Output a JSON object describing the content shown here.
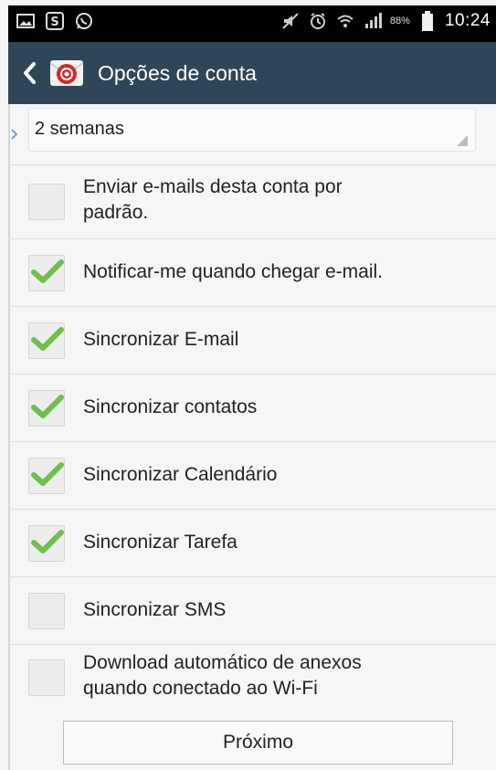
{
  "status_bar": {
    "left_icons": [
      "image-icon",
      "skype-icon",
      "whatsapp-icon"
    ],
    "right_icons": [
      "mute-icon",
      "alarm-icon",
      "wifi-icon",
      "signal-icon",
      "battery-icon"
    ],
    "battery_percent": "88%",
    "time": "10:24"
  },
  "action_bar": {
    "title": "Opções de conta",
    "background": "#2f4658"
  },
  "sync_period": {
    "selected": "2 semanas"
  },
  "options": [
    {
      "label_line1": "Enviar e-mails desta conta por",
      "label_line2": "padrão.",
      "checked": false
    },
    {
      "label_line1": "Notificar-me quando chegar e-mail.",
      "label_line2": "",
      "checked": true
    },
    {
      "label_line1": "Sincronizar E-mail",
      "label_line2": "",
      "checked": true
    },
    {
      "label_line1": "Sincronizar contatos",
      "label_line2": "",
      "checked": true
    },
    {
      "label_line1": "Sincronizar Calendário",
      "label_line2": "",
      "checked": true
    },
    {
      "label_line1": "Sincronizar Tarefa",
      "label_line2": "",
      "checked": true
    },
    {
      "label_line1": "Sincronizar SMS",
      "label_line2": "",
      "checked": false
    },
    {
      "label_line1": "Download automático de anexos",
      "label_line2": "quando conectado ao Wi-Fi",
      "checked": false
    }
  ],
  "footer": {
    "next_label": "Próximo"
  },
  "colors": {
    "check": "#6fbf4a",
    "checkbox_bg": "#ededed"
  }
}
